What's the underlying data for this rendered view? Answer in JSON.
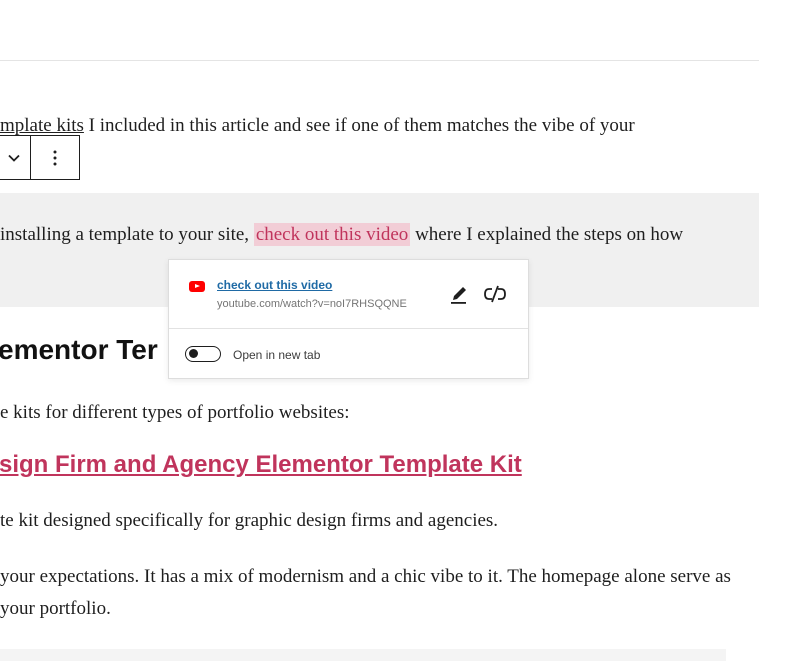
{
  "paragraph1": {
    "link_text": "mplate kits",
    "rest": " I included in this article and see if one of them matches the vibe of your"
  },
  "paragraph2": {
    "before": "installing a template to your site, ",
    "link_text": "check out this video",
    "after": " where I explained the steps on how"
  },
  "link_popover": {
    "title": "check out this video",
    "url": "youtube.com/watch?v=noI7RHSQQNE",
    "toggle_label": "Open in new tab",
    "toggle_on": false
  },
  "heading_partial": "ementor Ter",
  "paragraph3": "e kits for different types of portfolio websites:",
  "subheading": "sign Firm and Agency Elementor Template Kit",
  "paragraph4": "te kit designed specifically for graphic design firms and agencies.",
  "paragraph5": "your expectations. It has a mix of modernism and a chic vibe to it. The homepage alone serve as your portfolio.",
  "colors": {
    "link_pink": "#c0345c",
    "link_highlight_bg": "#f2cdd6",
    "selected_block_bg": "#f0f0f0",
    "popover_link_blue": "#1f6aa5",
    "youtube_red": "#ff0000"
  },
  "icons": {
    "toolbar_chevron": "chevron-down-icon",
    "toolbar_more": "more-vertical-icon",
    "popover_source": "youtube-icon",
    "edit": "pencil-icon",
    "unlink": "unlink-icon"
  }
}
